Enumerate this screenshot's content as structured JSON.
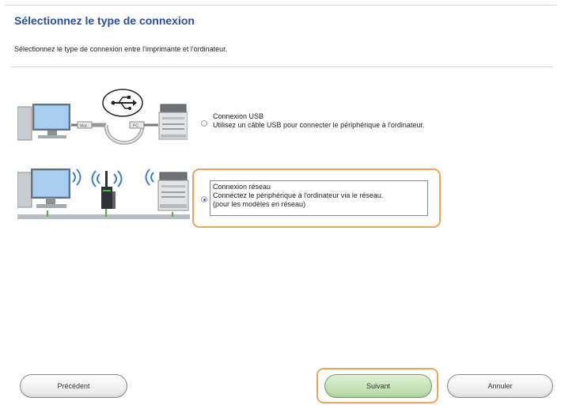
{
  "dialog": {
    "title": "Sélectionnez le type de connexion",
    "subtitle": "Sélectionnez le type de connexion entre l'imprimante et l'ordinateur."
  },
  "options": {
    "usb": {
      "label": "Connexion USB",
      "description": "Utilisez un câble USB pour connecter le périphérique à l'ordinateur.",
      "selected": false,
      "cable_labels": [
        "Mac",
        "PC"
      ]
    },
    "network": {
      "label": "Connexion réseau",
      "description": "Connectez le périphérique à l'ordinateur via le réseau.",
      "note": "(pour les modèles en réseau)",
      "selected": true
    }
  },
  "buttons": {
    "previous": "Précédent",
    "next": "Suivant",
    "cancel": "Annuler"
  },
  "colors": {
    "title": "#2b4f9e",
    "highlight": "#f0a458",
    "next_button": "#b5d9a3",
    "wifi": "#3f7fd0"
  }
}
